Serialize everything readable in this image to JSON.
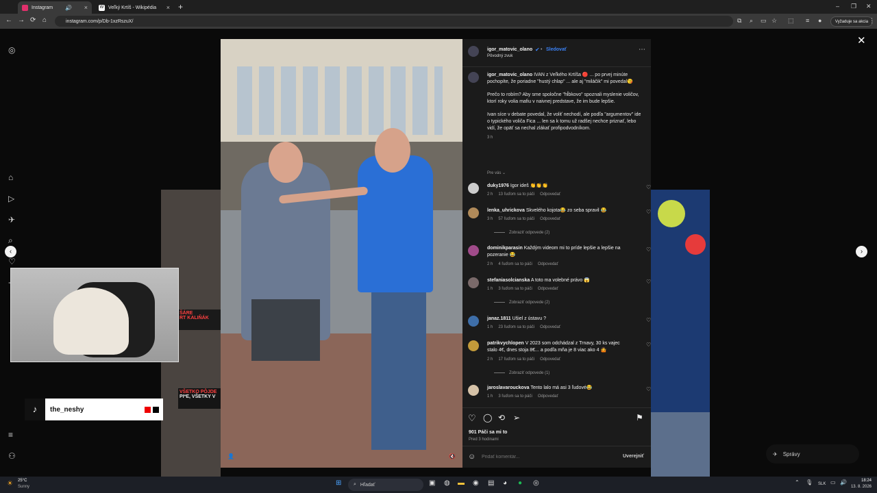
{
  "browser": {
    "tabs": [
      {
        "title": "Instagram",
        "favicon_color": "#e1306c"
      },
      {
        "title": "Veľký Krtíš - Wikipédia",
        "favicon_color": "#ffffff"
      }
    ],
    "url": "instagram.com/p/Db-1xzRszuX/",
    "update_label": "Vyžaduje sa akcia"
  },
  "post": {
    "author": "igor_matovic_olano",
    "follow_label": "Sledovať",
    "audio_label": "Pôvodný zvuk",
    "caption_author": "igor_matovic_olano",
    "caption_lines": [
      "IVAN z Veľkého Krtíša 🔴 ... po prvej minúte pochopíte, že poriadne \"hustý chlap\" ... ale aj \"miláčik\" mi povedal😘",
      "Prečo to robím? Aby sme spoločne \"hĺbkovo\" spoznali myslenie voličov, ktorí roky volia mafiu v naivnej predstave, že im bude lepšie.",
      "Ivan síce v debate povedal, že voliť nechodí, ale podľa \"argumentov\" ide o typického voliča Fica ... len sa k tomu už radšej nechce priznať, lebo vidí, že opäť sa nechal zlákať profipodvodníkom."
    ],
    "caption_time": "3 h",
    "filter_label": "Pre vás",
    "comments": [
      {
        "user": "duky1976",
        "text": "Igor ideš 👏👏👏",
        "time": "2 h",
        "likes": "13 ľuďom sa to páči",
        "reply": "Odpovedať",
        "replies": ""
      },
      {
        "user": "lenka_uhrickova",
        "text": "Skvelého kojota😂 zo seba spravil 😂",
        "time": "3 h",
        "likes": "57 ľuďom sa to páči",
        "reply": "Odpovedať",
        "replies": "Zobraziť odpovede (2)"
      },
      {
        "user": "dominikparasin",
        "text": "Každým videom mi to príde lepšie a lepšie na pozeranie 😂",
        "time": "2 h",
        "likes": "4 ľuďom sa to páči",
        "reply": "Odpovedať",
        "replies": ""
      },
      {
        "user": "stefaniasolcianska",
        "text": "A toto ma volebné právo 😱",
        "time": "1 h",
        "likes": "3 ľuďom sa to páči",
        "reply": "Odpovedať",
        "replies": "Zobraziť odpovede (2)"
      },
      {
        "user": "janaz.1811",
        "text": "Ušiel z ústavu ?",
        "time": "1 h",
        "likes": "23 ľuďom sa to páči",
        "reply": "Odpovedať",
        "replies": ""
      },
      {
        "user": "patrikvychlopen",
        "text": "V 2023 som odchádzal z Trnavy, 30 ks vajec stalo 4€, dnes stoja 8€... a podľa mňa je 8 viac ako 4 🤷",
        "time": "2 h",
        "likes": "17 ľuďom sa to páči",
        "reply": "Odpovedať",
        "replies": "Zobraziť odpovede (1)"
      },
      {
        "user": "jaroslavarouckova",
        "text": "Tento lalo má asi 3 ľudové😂",
        "time": "1 h",
        "likes": "3 ľuďom sa to páči",
        "reply": "Odpovedať",
        "replies": ""
      }
    ],
    "likes_total": "901 Páči sa mi to",
    "posted": "Pred 3 hodinami",
    "comment_placeholder": "Pridať komentár...",
    "publish_label": "Uverejniť"
  },
  "overlay": {
    "tiktok_name": "the_neshy",
    "bg_text_left": "VŠETKO PÔJDE",
    "bg_text_left2": "PI*E, VŠETKY V",
    "bg_text_left3": "ŠÁRE",
    "bg_text_left4": "RT KALIŇÁK",
    "messages_label": "Správy"
  },
  "taskbar": {
    "weather_temp": "25°C",
    "weather_text": "Sunny",
    "search_placeholder": "Hľadať",
    "language": "SLK",
    "time": "18:24",
    "date": "13. 8. 2026"
  }
}
